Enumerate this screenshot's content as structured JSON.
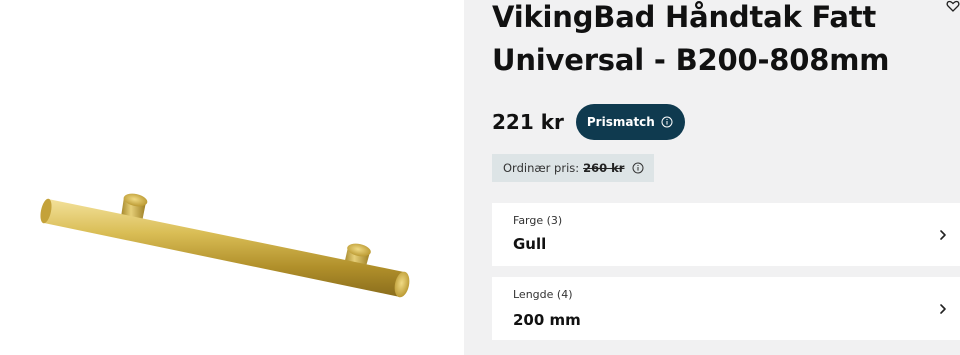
{
  "product": {
    "title_line1": "VikingBad Håndtak Fatt",
    "title_line2": "Universal - B200-808mm",
    "image_alt": "Brass bar cabinet handle"
  },
  "price": {
    "current": "221 kr",
    "prismatch_label": "Prismatch",
    "ordinary_label": "Ordinær pris:",
    "ordinary_value": "260 kr"
  },
  "options": {
    "color": {
      "label": "Farge (3)",
      "value": "Gull"
    },
    "length": {
      "label": "Lengde (4)",
      "value": "200 mm"
    }
  },
  "colors": {
    "brand_dark": "#0f3a4f",
    "panel_bg": "#f1f1f2",
    "ordinary_bg": "#dde4e6",
    "handle_gold": "#c9a93a"
  },
  "icons": [
    "favorite-icon",
    "info-icon",
    "chevron-right-icon"
  ]
}
